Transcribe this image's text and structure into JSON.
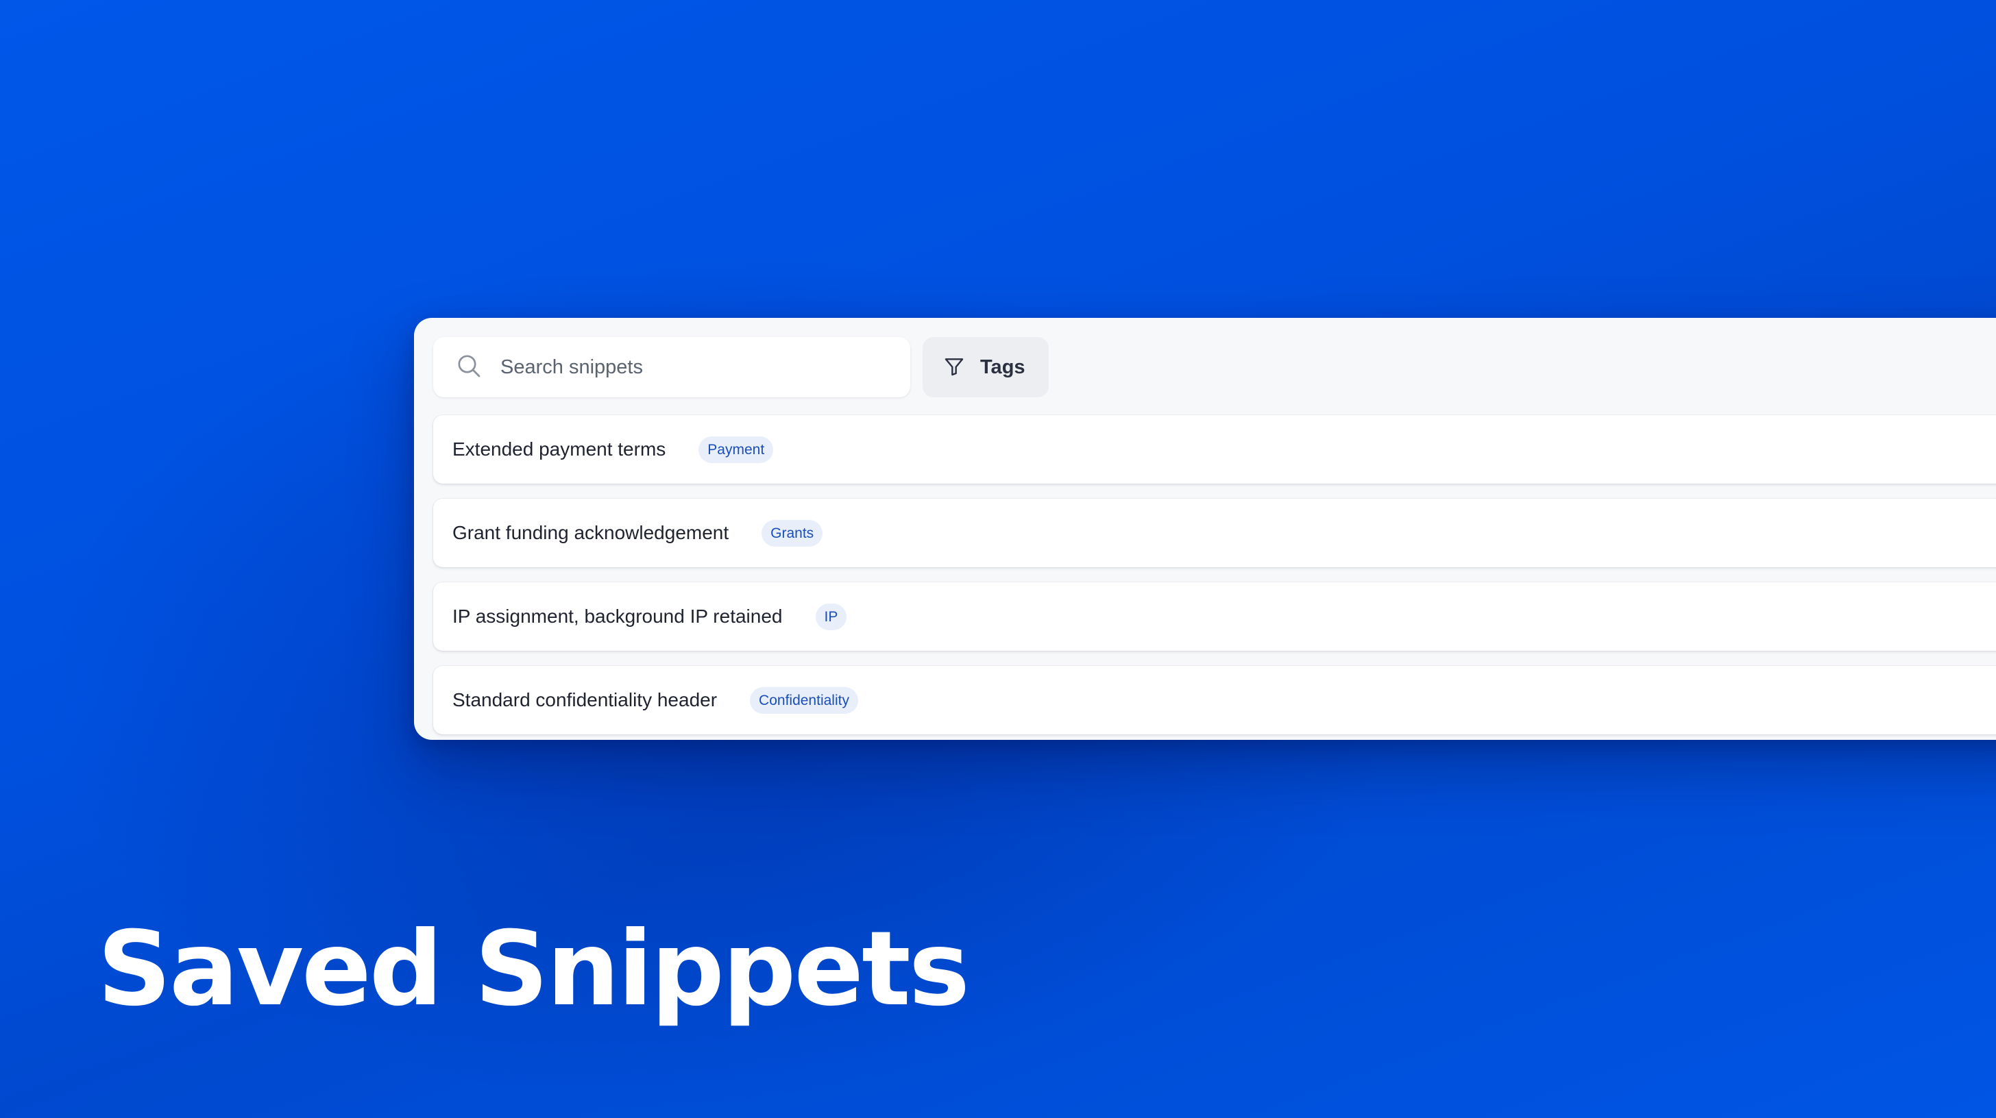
{
  "search": {
    "placeholder": "Search snippets",
    "value": "",
    "icon": "search-icon"
  },
  "filter": {
    "label": "Tags",
    "icon": "filter-icon"
  },
  "snippets": [
    {
      "title": "Extended payment terms",
      "tag": "Payment"
    },
    {
      "title": "Grant funding acknowledgement",
      "tag": "Grants"
    },
    {
      "title": "IP assignment, background IP retained",
      "tag": "IP"
    },
    {
      "title": "Standard confidentiality header",
      "tag": "Confidentiality"
    }
  ],
  "row_action_icon": "trash-icon",
  "headline": "Saved Snippets",
  "colors": {
    "background": "#0052e0",
    "panel": "#f7f8fa",
    "tag_background": "#e8effb",
    "tag_text": "#1b4fb8",
    "headline": "#ffffff"
  }
}
